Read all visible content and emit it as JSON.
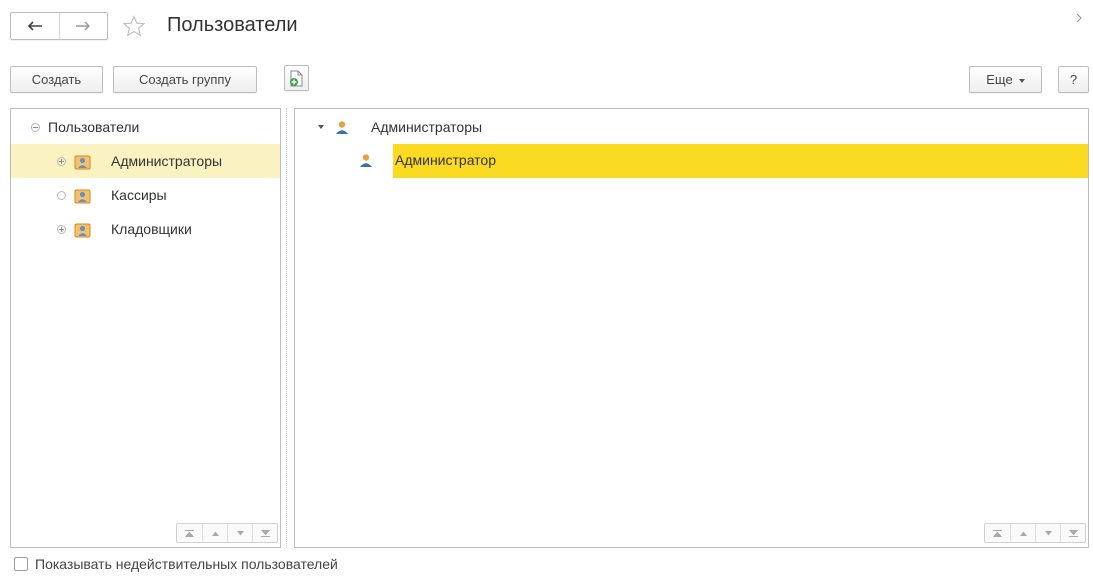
{
  "header": {
    "title": "Пользователи",
    "back_icon": "arrow-left-icon",
    "forward_icon": "arrow-right-icon",
    "favorite_icon": "star-outline-icon",
    "collapse_icon": "chevron-right-icon"
  },
  "toolbar": {
    "create_label": "Создать",
    "create_group_label": "Создать группу",
    "new_doc_icon": "document-add-icon",
    "more_label": "Еще",
    "help_label": "?"
  },
  "groups_tree": {
    "root_label": "Пользователи",
    "items": [
      {
        "label": "Администраторы",
        "expander": "plus",
        "selected": true
      },
      {
        "label": "Кассиры",
        "expander": "empty",
        "selected": false
      },
      {
        "label": "Кладовщики",
        "expander": "plus",
        "selected": false
      }
    ]
  },
  "users_list": {
    "group_label": "Администраторы",
    "rows": [
      {
        "label": "Администратор",
        "selected": true
      }
    ]
  },
  "footer": {
    "show_invalid_label": "Показывать недействительных пользователей",
    "show_invalid_checked": false
  },
  "colors": {
    "selection_row": "#fbda22",
    "selection_tree": "#fbf2c2",
    "icon_orange": "#e8a33d",
    "icon_user_blue": "#3b6fa8"
  }
}
